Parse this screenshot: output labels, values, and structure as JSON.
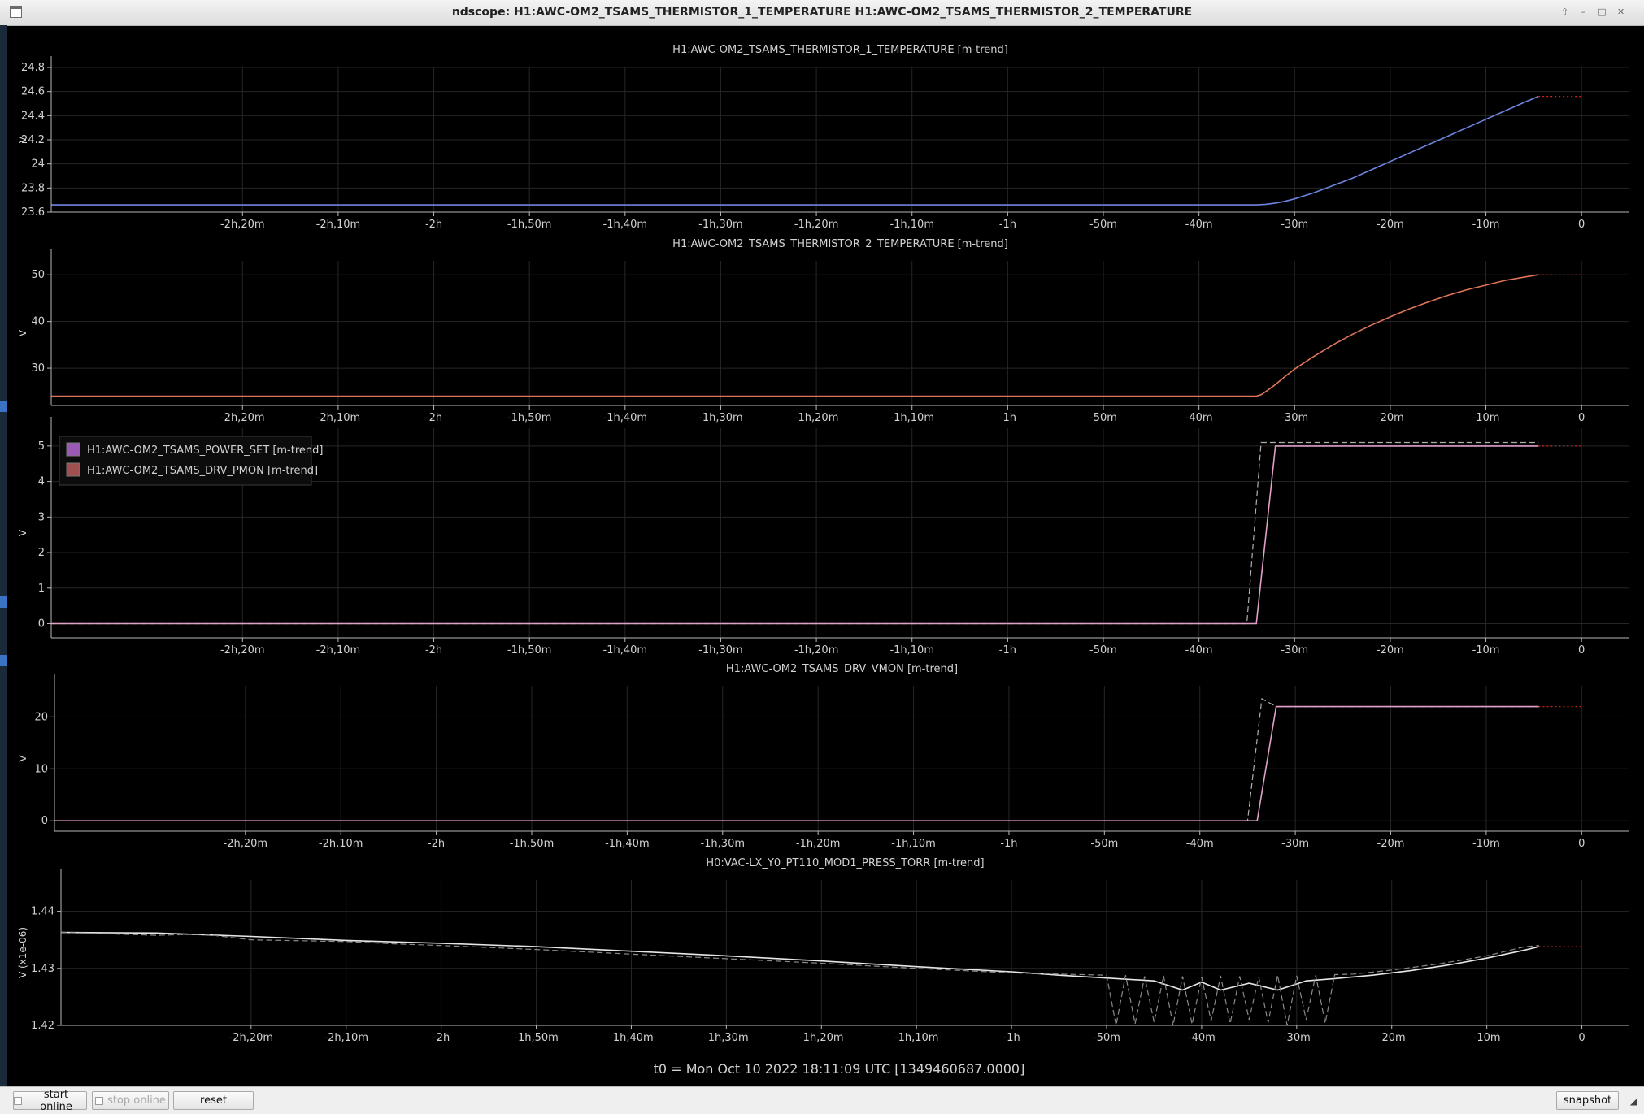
{
  "window": {
    "title": "ndscope: H1:AWC-OM2_TSAMS_THERMISTOR_1_TEMPERATURE H1:AWC-OM2_TSAMS_THERMISTOR_2_TEMPERATURE",
    "controls": [
      "⇧",
      "–",
      "□",
      "✕"
    ]
  },
  "colors": {
    "background": "#000000",
    "axis": "#b9b9b9",
    "grid": "#262626",
    "text": "#d2d2d2"
  },
  "chart_data": [
    {
      "type": "line",
      "title": "H1:AWC-OM2_TSAMS_THERMISTOR_1_TEMPERATURE [m-trend]",
      "ylabel": "V",
      "xlim": [
        -160,
        5
      ],
      "ylim": [
        23.6,
        24.8
      ],
      "yticks": [
        23.6,
        23.8,
        24,
        24.2,
        24.4,
        24.6,
        24.8
      ],
      "ytick_labels": [
        "23.6",
        "23.8",
        "24",
        "24.2",
        "24.4",
        "24.6",
        "24.8"
      ],
      "xticks": [
        -140,
        -130,
        -120,
        -110,
        -100,
        -90,
        -80,
        -70,
        -60,
        -50,
        -40,
        -30,
        -20,
        -10,
        0
      ],
      "xtick_labels": [
        "-2h,20m",
        "-2h,10m",
        "-2h",
        "-1h,50m",
        "-1h,40m",
        "-1h,30m",
        "-1h,20m",
        "-1h,10m",
        "-1h",
        "-50m",
        "-40m",
        "-30m",
        "-20m",
        "-10m",
        "0"
      ],
      "grid": true,
      "legend": "none",
      "series": [
        {
          "color": "#6d84e0",
          "style": "solid",
          "x": [
            -160,
            -34,
            -33,
            -32,
            -31,
            -30,
            -28,
            -26,
            -24,
            -22,
            -20,
            -18,
            -16,
            -14,
            -12,
            -10,
            -8,
            -6,
            -4.5
          ],
          "y": [
            23.66,
            23.66,
            23.665,
            23.675,
            23.69,
            23.71,
            23.76,
            23.82,
            23.88,
            23.95,
            24.02,
            24.09,
            24.16,
            24.23,
            24.3,
            24.37,
            24.44,
            24.51,
            24.56
          ]
        },
        {
          "color": "#c8281e",
          "style": "dotted",
          "x": [
            -4.5,
            0
          ],
          "y": [
            24.56,
            24.56
          ]
        }
      ]
    },
    {
      "type": "line",
      "title": "H1:AWC-OM2_TSAMS_THERMISTOR_2_TEMPERATURE [m-trend]",
      "ylabel": "V",
      "xlim": [
        -160,
        5
      ],
      "ylim": [
        22,
        53
      ],
      "yticks": [
        30,
        40,
        50
      ],
      "ytick_labels": [
        "30",
        "40",
        "50"
      ],
      "xticks": [
        -140,
        -130,
        -120,
        -110,
        -100,
        -90,
        -80,
        -70,
        -60,
        -50,
        -40,
        -30,
        -20,
        -10,
        0
      ],
      "xtick_labels": [
        "-2h,20m",
        "-2h,10m",
        "-2h",
        "-1h,50m",
        "-1h,40m",
        "-1h,30m",
        "-1h,20m",
        "-1h,10m",
        "-1h",
        "-50m",
        "-40m",
        "-30m",
        "-20m",
        "-10m",
        "0"
      ],
      "grid": true,
      "legend": "none",
      "series": [
        {
          "color": "#e07458",
          "style": "solid",
          "x": [
            -160,
            -34,
            -33.5,
            -33,
            -32,
            -31,
            -30,
            -28,
            -26,
            -24,
            -22,
            -20,
            -18,
            -16,
            -14,
            -12,
            -10,
            -8,
            -6,
            -4.5
          ],
          "y": [
            24,
            24,
            24.3,
            25,
            26.5,
            28.2,
            29.8,
            32.5,
            35,
            37.2,
            39.2,
            41,
            42.7,
            44.2,
            45.6,
            46.8,
            47.8,
            48.8,
            49.5,
            50
          ]
        },
        {
          "color": "#c8281e",
          "style": "dotted",
          "x": [
            -4.5,
            0
          ],
          "y": [
            50,
            50
          ]
        }
      ]
    },
    {
      "type": "line",
      "title": "",
      "ylabel": "V",
      "xlim": [
        -160,
        5
      ],
      "ylim": [
        -0.4,
        5.5
      ],
      "yticks": [
        0,
        1,
        2,
        3,
        4,
        5
      ],
      "ytick_labels": [
        "0",
        "1",
        "2",
        "3",
        "4",
        "5"
      ],
      "xticks": [
        -140,
        -130,
        -120,
        -110,
        -100,
        -90,
        -80,
        -70,
        -60,
        -50,
        -40,
        -30,
        -20,
        -10,
        0
      ],
      "xtick_labels": [
        "-2h,20m",
        "-2h,10m",
        "-2h",
        "-1h,50m",
        "-1h,40m",
        "-1h,30m",
        "-1h,20m",
        "-1h,10m",
        "-1h",
        "-50m",
        "-40m",
        "-30m",
        "-20m",
        "-10m",
        "0"
      ],
      "grid": true,
      "legend": "top-left",
      "legend_entries": [
        {
          "label": "H1:AWC-OM2_TSAMS_POWER_SET [m-trend]",
          "color": "#9b59b6"
        },
        {
          "label": "H1:AWC-OM2_TSAMS_DRV_PMON [m-trend]",
          "color": "#a05050"
        }
      ],
      "series": [
        {
          "color": "#b0b0b0",
          "style": "dashed",
          "x": [
            -160,
            -35,
            -33.5,
            -4.5
          ],
          "y": [
            0,
            0,
            5.1,
            5.1
          ]
        },
        {
          "color": "#e0a0c8",
          "style": "solid",
          "x": [
            -160,
            -34,
            -32,
            -4.5
          ],
          "y": [
            0,
            0,
            5.0,
            5.0
          ]
        },
        {
          "color": "#c8281e",
          "style": "dotted",
          "x": [
            -4.5,
            0
          ],
          "y": [
            5.0,
            5.0
          ]
        }
      ]
    },
    {
      "type": "line",
      "title": "H1:AWC-OM2_TSAMS_DRV_VMON [m-trend]",
      "ylabel": "V",
      "xlim": [
        -160,
        5
      ],
      "ylim": [
        -2,
        26
      ],
      "yticks": [
        0,
        10,
        20
      ],
      "ytick_labels": [
        "0",
        "10",
        "20"
      ],
      "xticks": [
        -140,
        -130,
        -120,
        -110,
        -100,
        -90,
        -80,
        -70,
        -60,
        -50,
        -40,
        -30,
        -20,
        -10,
        0
      ],
      "xtick_labels": [
        "-2h,20m",
        "-2h,10m",
        "-2h",
        "-1h,50m",
        "-1h,40m",
        "-1h,30m",
        "-1h,20m",
        "-1h,10m",
        "-1h",
        "-50m",
        "-40m",
        "-30m",
        "-20m",
        "-10m",
        "0"
      ],
      "grid": true,
      "legend": "none",
      "series": [
        {
          "color": "#b0b0b0",
          "style": "dashed",
          "x": [
            -160,
            -35,
            -33.5,
            -32.5,
            -32,
            -4.5
          ],
          "y": [
            0,
            0,
            23.5,
            22.5,
            22,
            22
          ]
        },
        {
          "color": "#e0a0c8",
          "style": "solid",
          "x": [
            -160,
            -34,
            -32,
            -4.5
          ],
          "y": [
            0,
            0,
            22,
            22
          ]
        },
        {
          "color": "#c8281e",
          "style": "dotted",
          "x": [
            -4.5,
            0
          ],
          "y": [
            22,
            22
          ]
        }
      ]
    },
    {
      "type": "line",
      "title": "H0:VAC-LX_Y0_PT110_MOD1_PRESS_TORR [m-trend]",
      "ylabel": "V (x1e-06)",
      "xlim": [
        -160,
        5
      ],
      "ylim": [
        1.42,
        1.4455
      ],
      "yticks": [
        1.42,
        1.43,
        1.44
      ],
      "ytick_labels": [
        "1.42",
        "1.43",
        "1.44"
      ],
      "xticks": [
        -140,
        -130,
        -120,
        -110,
        -100,
        -90,
        -80,
        -70,
        -60,
        -50,
        -40,
        -30,
        -20,
        -10,
        0
      ],
      "xtick_labels": [
        "-2h,20m",
        "-2h,10m",
        "-2h",
        "-1h,50m",
        "-1h,40m",
        "-1h,30m",
        "-1h,20m",
        "-1h,10m",
        "-1h",
        "-50m",
        "-40m",
        "-30m",
        "-20m",
        "-10m",
        "0"
      ],
      "grid": true,
      "legend": "none",
      "series": [
        {
          "color": "#e6e6e6",
          "style": "solid",
          "x": [
            -160,
            -150,
            -140,
            -130,
            -120,
            -110,
            -100,
            -90,
            -80,
            -70,
            -60,
            -55,
            -50,
            -45,
            -42,
            -40,
            -38,
            -35,
            -32,
            -29,
            -26,
            -22,
            -18,
            -14,
            -10,
            -6,
            -4.5
          ],
          "y": [
            1.4363,
            1.4362,
            1.4356,
            1.4349,
            1.4344,
            1.4338,
            1.433,
            1.4322,
            1.4313,
            1.4303,
            1.4294,
            1.4288,
            1.4283,
            1.4278,
            1.4262,
            1.4276,
            1.4262,
            1.4274,
            1.4262,
            1.4278,
            1.4282,
            1.4288,
            1.4296,
            1.4306,
            1.4318,
            1.4332,
            1.4338
          ]
        },
        {
          "color": "#8a8a8a",
          "style": "dashed",
          "x": [
            -160,
            -150,
            -145,
            -140,
            -130,
            -125,
            -120,
            -110,
            -100,
            -90,
            -80,
            -70,
            -60,
            -50,
            -49,
            -48,
            -47,
            -46,
            -45,
            -44,
            -43,
            -42,
            -41,
            -40,
            -39,
            -38,
            -37,
            -36,
            -35,
            -34,
            -33,
            -32,
            -31,
            -30,
            -29,
            -28,
            -27,
            -26,
            -24,
            -20,
            -15,
            -10,
            -6,
            -4.5
          ],
          "y": [
            1.4363,
            1.4358,
            1.436,
            1.435,
            1.4347,
            1.4343,
            1.434,
            1.4333,
            1.4325,
            1.4317,
            1.4309,
            1.43,
            1.4292,
            1.4288,
            1.42,
            1.4288,
            1.4203,
            1.4286,
            1.4205,
            1.4287,
            1.42,
            1.4286,
            1.4202,
            1.4285,
            1.4208,
            1.4287,
            1.4203,
            1.4286,
            1.421,
            1.4285,
            1.4205,
            1.4288,
            1.42,
            1.4287,
            1.421,
            1.4288,
            1.4204,
            1.4289,
            1.429,
            1.4297,
            1.4308,
            1.4322,
            1.4338,
            1.434
          ]
        },
        {
          "color": "#c8281e",
          "style": "dotted",
          "x": [
            -4.5,
            0
          ],
          "y": [
            1.4338,
            1.4338
          ]
        }
      ]
    }
  ],
  "footer": {
    "t0": "t0 = Mon Oct 10 2022 18:11:09 UTC [1349460687.0000]"
  },
  "toolbar": {
    "start_online": "start online",
    "stop_online": "stop online",
    "reset": "reset",
    "snapshot": "snapshot",
    "grip": "◢"
  }
}
